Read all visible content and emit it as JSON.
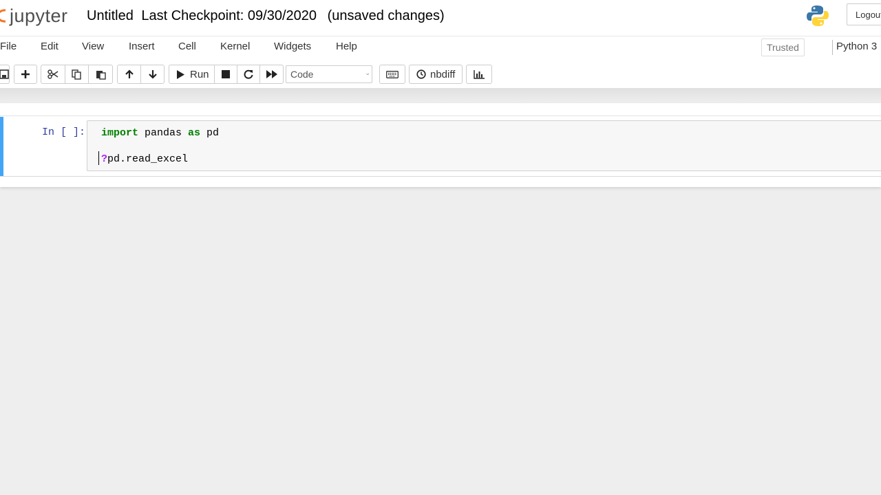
{
  "header": {
    "logo_text": "jupyter",
    "notebook_name": "Untitled",
    "checkpoint": "Last Checkpoint: 09/30/2020",
    "autosave_status": "(unsaved changes)",
    "logout_label": "Logout"
  },
  "menubar": {
    "items": [
      "File",
      "Edit",
      "View",
      "Insert",
      "Cell",
      "Kernel",
      "Widgets",
      "Help"
    ],
    "trusted_label": "Trusted",
    "kernel_name": "Python 3"
  },
  "toolbar": {
    "run_label": "Run",
    "cell_type": "Code",
    "nbdiff_label": "nbdiff",
    "icons": [
      "save-icon",
      "plus-icon",
      "cut-icon",
      "copy-icon",
      "paste-icon",
      "arrow-up-icon",
      "arrow-down-icon",
      "play-icon",
      "stop-icon",
      "restart-icon",
      "fast-forward-icon",
      "keyboard-icon",
      "clock-icon",
      "bar-chart-icon"
    ]
  },
  "cell": {
    "prompt": "In [ ]:",
    "line1": {
      "keyword1": "import",
      "name": " pandas ",
      "keyword2": "as",
      "alias": " pd"
    },
    "line2": {
      "operator": "?",
      "text": "pd.read_excel"
    }
  },
  "colors": {
    "selected_cell_border": "#42a5f5",
    "prompt": "#303f9f",
    "keyword": "#008000",
    "operator": "#aa22ff",
    "jupyter_orange": "#f37626"
  }
}
